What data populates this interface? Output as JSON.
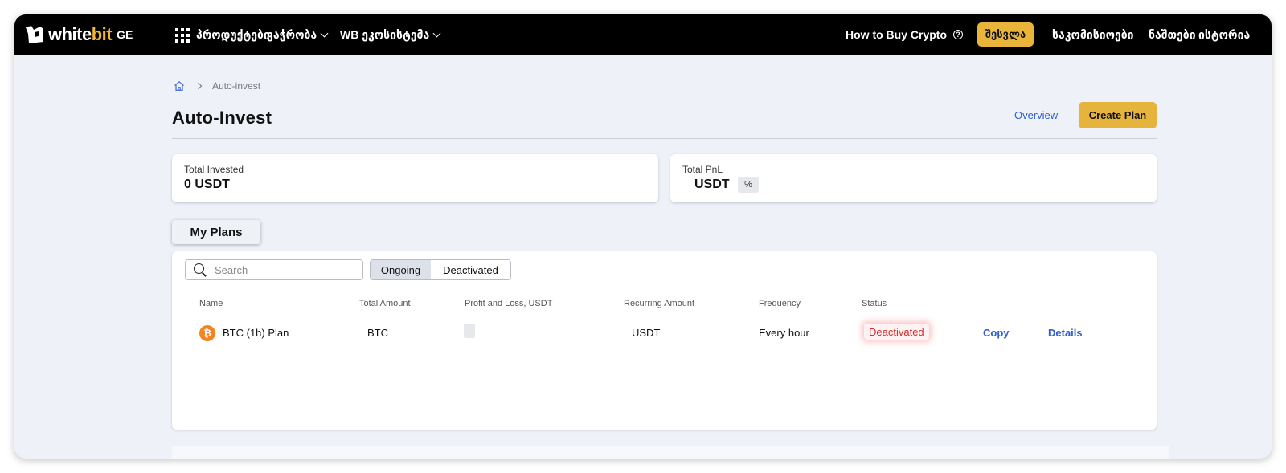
{
  "header": {
    "logo_white": "white",
    "logo_bit": "bit",
    "logo_region": "GE",
    "nav_products": "პროდუქტები",
    "nav_trading": "ვაჭრობა",
    "nav_ecosystem": "WB ეკოსისტემა",
    "how_to_buy": "How to Buy Crypto",
    "login": "შესვლა",
    "fees": "საკომისიოები",
    "assets": "ნაშთები",
    "history": "ისტორია"
  },
  "breadcrumb": {
    "current": "Auto-invest"
  },
  "page": {
    "title": "Auto-Invest",
    "overview_link": "Overview",
    "create_plan": "Create Plan"
  },
  "stats": {
    "total_invested_label": "Total Invested",
    "total_invested_value": "0 USDT",
    "total_pnl_label": "Total PnL",
    "total_pnl_value": "USDT",
    "total_pnl_pct": "%"
  },
  "plans": {
    "tab_label": "My Plans",
    "search_placeholder": "Search",
    "filter_ongoing": "Ongoing",
    "filter_deactivated": "Deactivated",
    "columns": {
      "name": "Name",
      "total_amount": "Total Amount",
      "pnl": "Profit and Loss, USDT",
      "recurring": "Recurring Amount",
      "frequency": "Frequency",
      "status": "Status"
    },
    "rows": [
      {
        "name": "BTC (1h) Plan",
        "total_amount": "BTC",
        "recurring_amount": "USDT",
        "frequency": "Every hour",
        "status": "Deactivated",
        "copy": "Copy",
        "details": "Details"
      }
    ]
  },
  "colors": {
    "accent": "#e6b43c",
    "link": "#2f5fd0",
    "status_deactivated": "#d62c2c",
    "btc": "#f4841f"
  }
}
